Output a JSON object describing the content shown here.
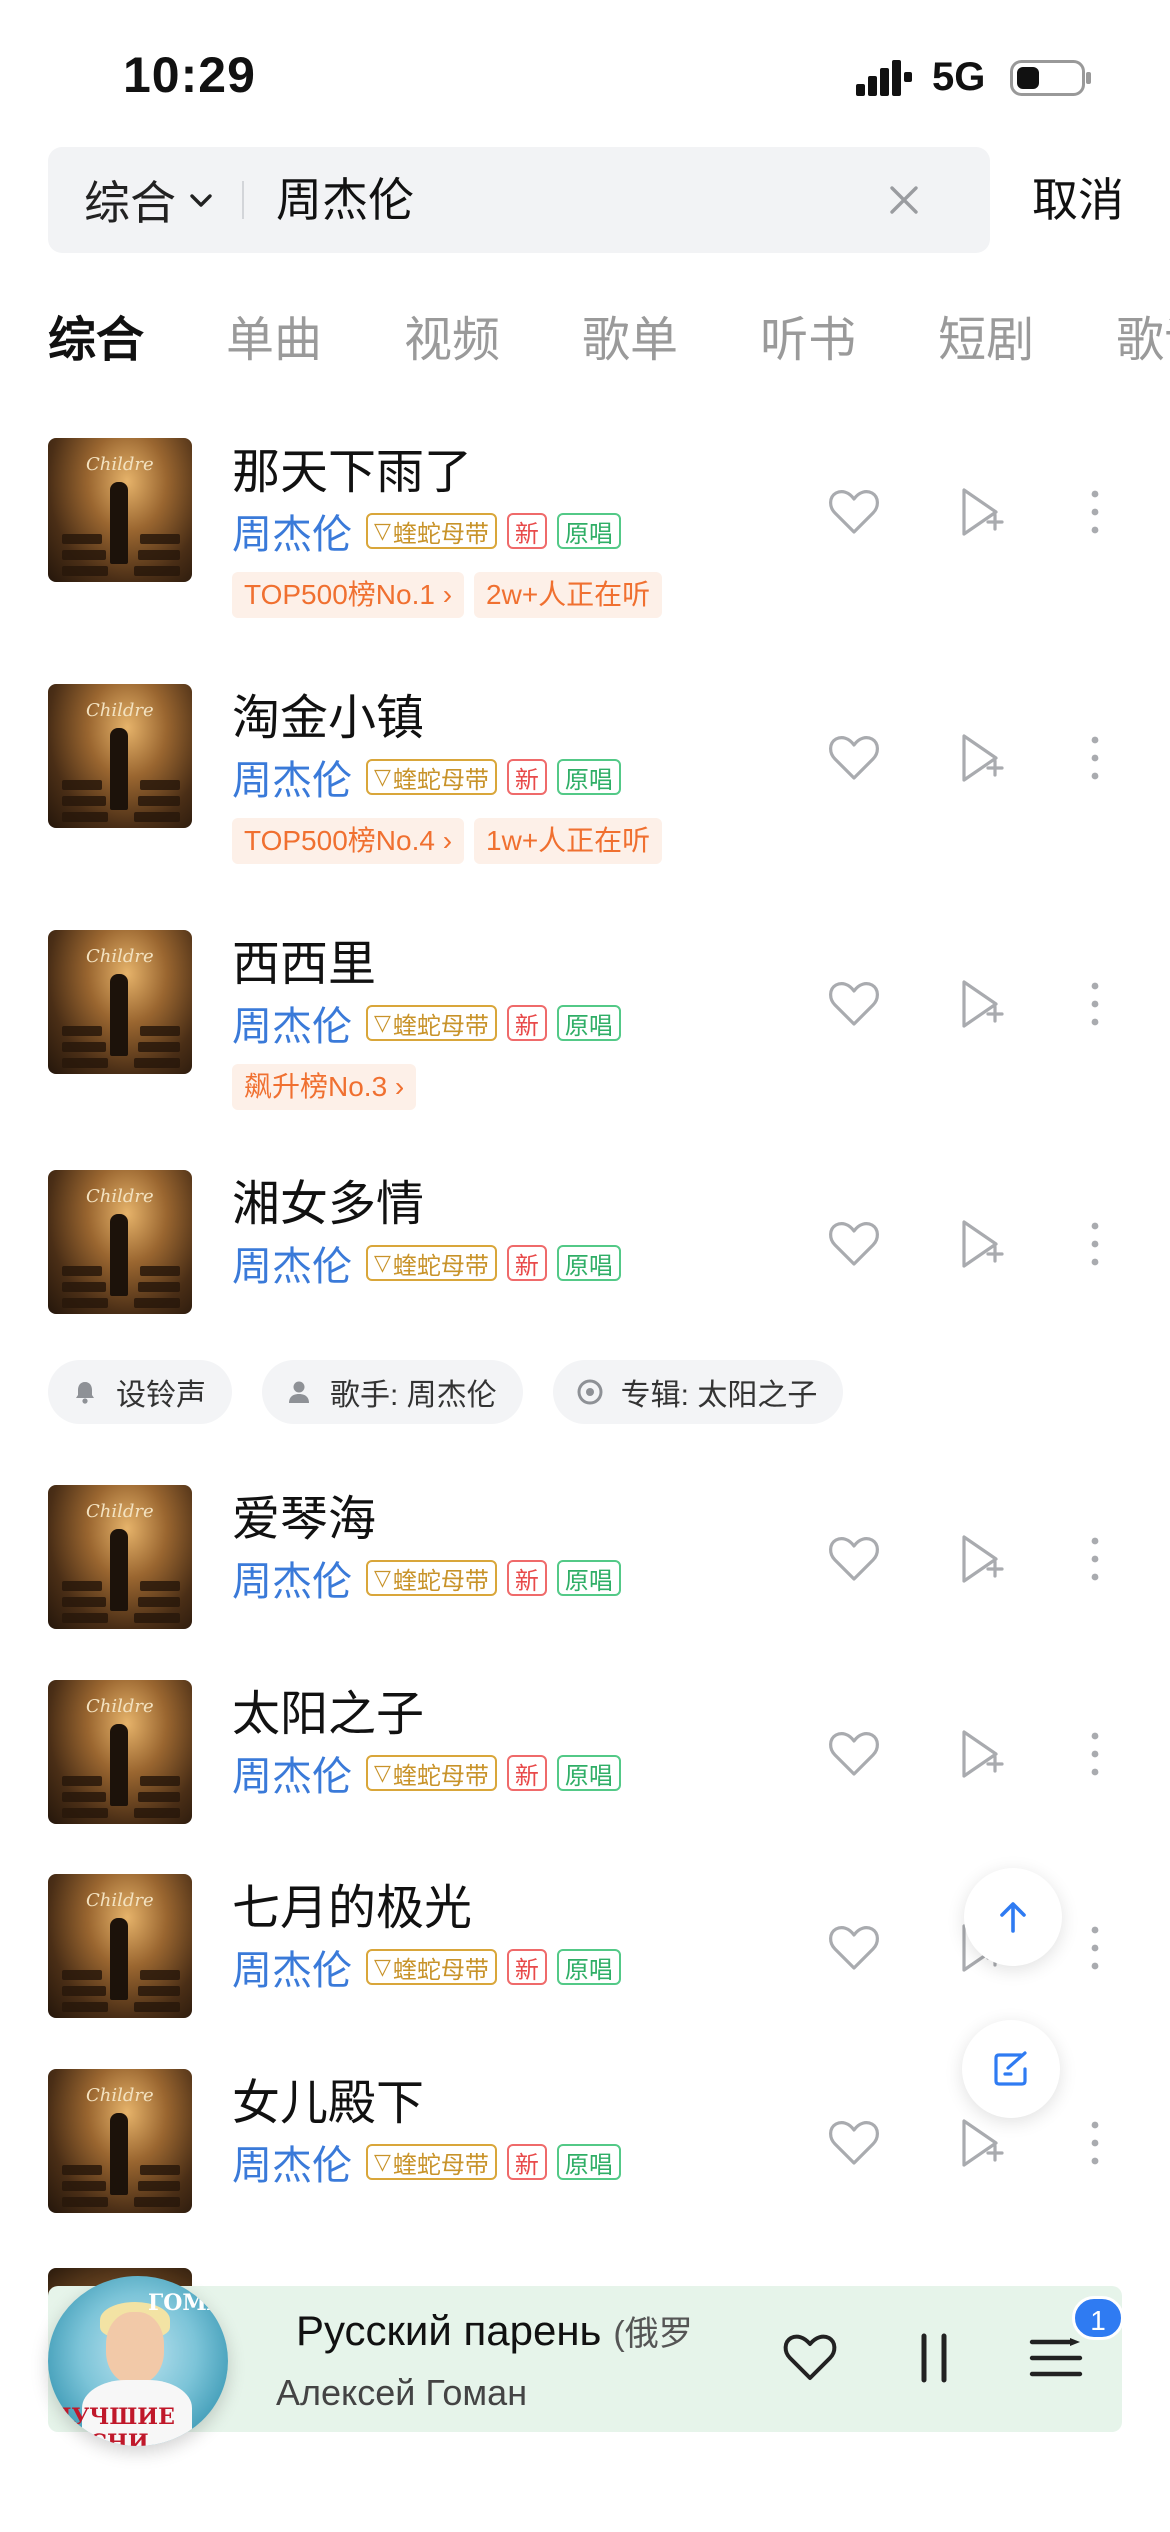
{
  "status_bar": {
    "time": "10:29",
    "network": "5G"
  },
  "search": {
    "scope": "综合",
    "query": "周杰伦",
    "cancel_label": "取消"
  },
  "tabs": [
    "综合",
    "单曲",
    "视频",
    "歌单",
    "听书",
    "短剧",
    "歌词"
  ],
  "tag_labels": {
    "vip": "蝰蛇母带",
    "new": "新",
    "original": "原唱"
  },
  "songs": [
    {
      "title": "那天下雨了",
      "artist": "周杰伦",
      "badges": [
        "TOP500榜No.1 ›",
        "2w+人正在听"
      ]
    },
    {
      "title": "淘金小镇",
      "artist": "周杰伦",
      "badges": [
        "TOP500榜No.4 ›",
        "1w+人正在听"
      ]
    },
    {
      "title": "西西里",
      "artist": "周杰伦",
      "badges": [
        "飙升榜No.3 ›"
      ]
    },
    {
      "title": "湘女多情",
      "artist": "周杰伦",
      "badges": []
    },
    {
      "title": "爱琴海",
      "artist": "周杰伦",
      "badges": []
    },
    {
      "title": "太阳之子",
      "artist": "周杰伦",
      "badges": []
    },
    {
      "title": "七月的极光",
      "artist": "周杰伦",
      "badges": []
    },
    {
      "title": "女儿殿下",
      "artist": "周杰伦",
      "badges": []
    }
  ],
  "chips": [
    {
      "label": "设铃声",
      "icon": "bell-icon"
    },
    {
      "label": "歌手: 周杰伦",
      "icon": "person-icon"
    },
    {
      "label": "专辑: 太阳之子",
      "icon": "disc-icon"
    }
  ],
  "now_playing": {
    "title": "Русский парень",
    "title_suffix": "(俄罗",
    "artist": "Алексей Гоман",
    "queue_count": "1",
    "cover_text_top": "ГОМАН",
    "cover_text_bottom": "ЛУЧШИЕ ПЕСНИ"
  },
  "colors": {
    "artist": "#3a7ad9",
    "badge_text": "#f07030",
    "badge_bg": "#fdf0e8",
    "accent": "#2f7bf2",
    "player_bg": "#e6f4ea"
  }
}
